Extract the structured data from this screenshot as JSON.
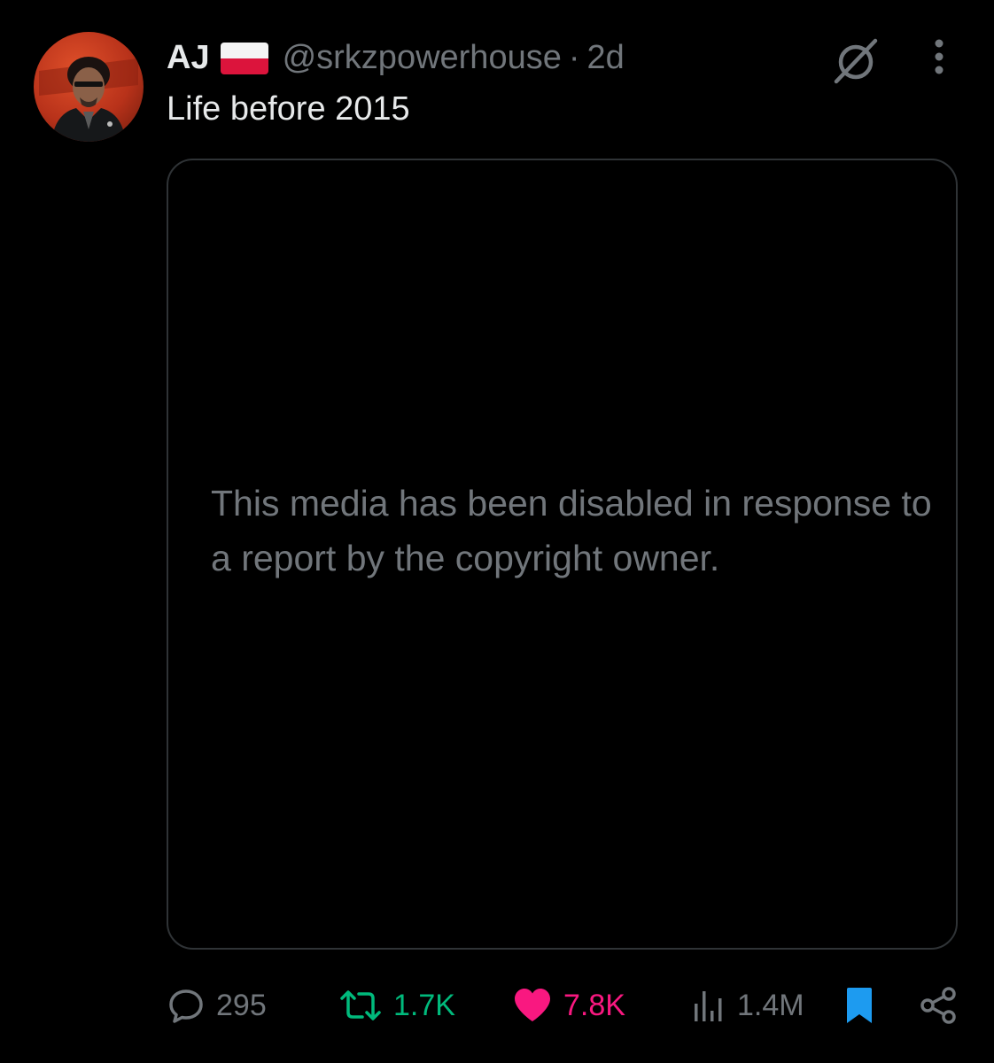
{
  "author": {
    "display_name": "AJ",
    "flag_icon": "poland-flag-icon",
    "handle": "@srkzpowerhouse",
    "separator": "·",
    "time_ago": "2d"
  },
  "header_icons": {
    "grok": "grok-icon",
    "more": "more-vertical-icon"
  },
  "tweet": {
    "text": "Life before 2015"
  },
  "media": {
    "notice": "This media has been disabled in response to a report by the copyright owner."
  },
  "actions": {
    "replies": "295",
    "reposts": "1.7K",
    "likes": "7.8K",
    "views": "1.4M"
  },
  "colors": {
    "background": "#000000",
    "text_primary": "#e7e9ea",
    "text_secondary": "#71767b",
    "border": "#2f3336",
    "repost_active": "#00ba7c",
    "like_active": "#f91880",
    "bookmark_active": "#1d9bf0"
  }
}
